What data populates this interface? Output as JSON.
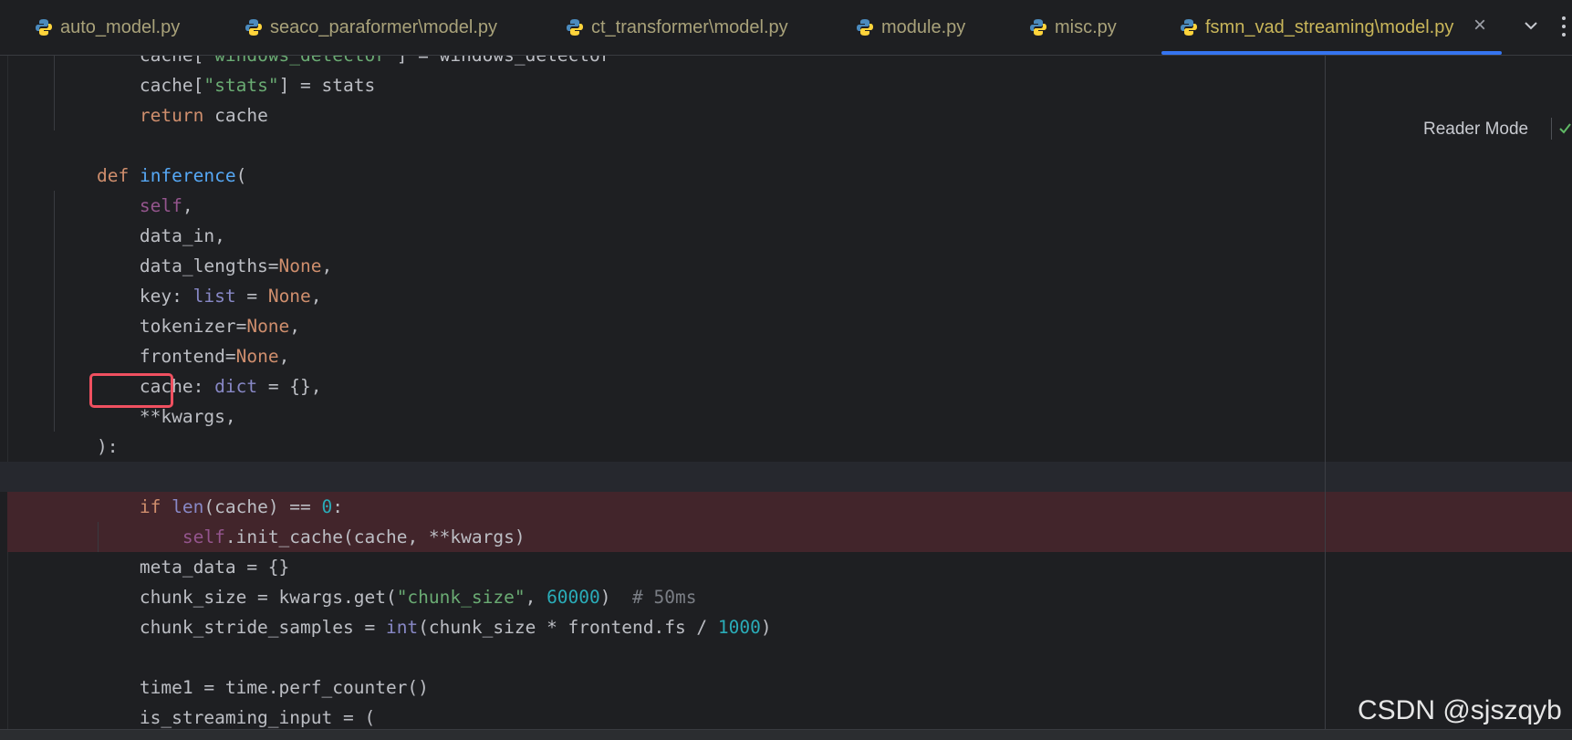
{
  "tabs": [
    {
      "label": "auto_model.py",
      "active": false
    },
    {
      "label": "seaco_paraformer\\model.py",
      "active": false
    },
    {
      "label": "ct_transformer\\model.py",
      "active": false
    },
    {
      "label": "module.py",
      "active": false
    },
    {
      "label": "misc.py",
      "active": false
    },
    {
      "label": "fsmn_vad_streaming\\model.py",
      "active": true
    }
  ],
  "tab_close": "×",
  "reader_mode": "Reader Mode",
  "watermark": "CSDN @sjszqyb",
  "code_lines": [
    "        cache[\"windows_detector\"] = windows_detector",
    "        cache[\"stats\"] = stats",
    "        return cache",
    "",
    "    def inference(",
    "        self,",
    "        data_in,",
    "        data_lengths=None,",
    "        key: list = None,",
    "        tokenizer=None,",
    "        frontend=None,",
    "        cache: dict = {},",
    "        **kwargs,",
    "    ):",
    "",
    "        if len(cache) == 0:",
    "            self.init_cache(cache, **kwargs)",
    "        meta_data = {}",
    "        chunk_size = kwargs.get(\"chunk_size\", 60000)  # 50ms",
    "        chunk_stride_samples = int(chunk_size * frontend.fs / 1000)",
    "",
    "        time1 = time.perf_counter()",
    "        is_streaming_input = ("
  ],
  "highlighted_token": "cache:",
  "breakpoint_lines": [
    15,
    16
  ],
  "caret_line": 14,
  "colors": {
    "background": "#1e1f22",
    "keyword": "#cf8e6d",
    "function": "#56a8f5",
    "self": "#94558d",
    "builtin": "#8888c6",
    "string": "#6aab73",
    "number": "#2aacb8",
    "comment": "#7a7e85",
    "breakpoint_bg": "#42252b",
    "highlight_box": "#f05060",
    "tab_accent": "#3574f0"
  },
  "icons": [
    "python-file-icon",
    "close-icon",
    "chevron-down-icon",
    "more-vertical-icon",
    "check-icon"
  ]
}
